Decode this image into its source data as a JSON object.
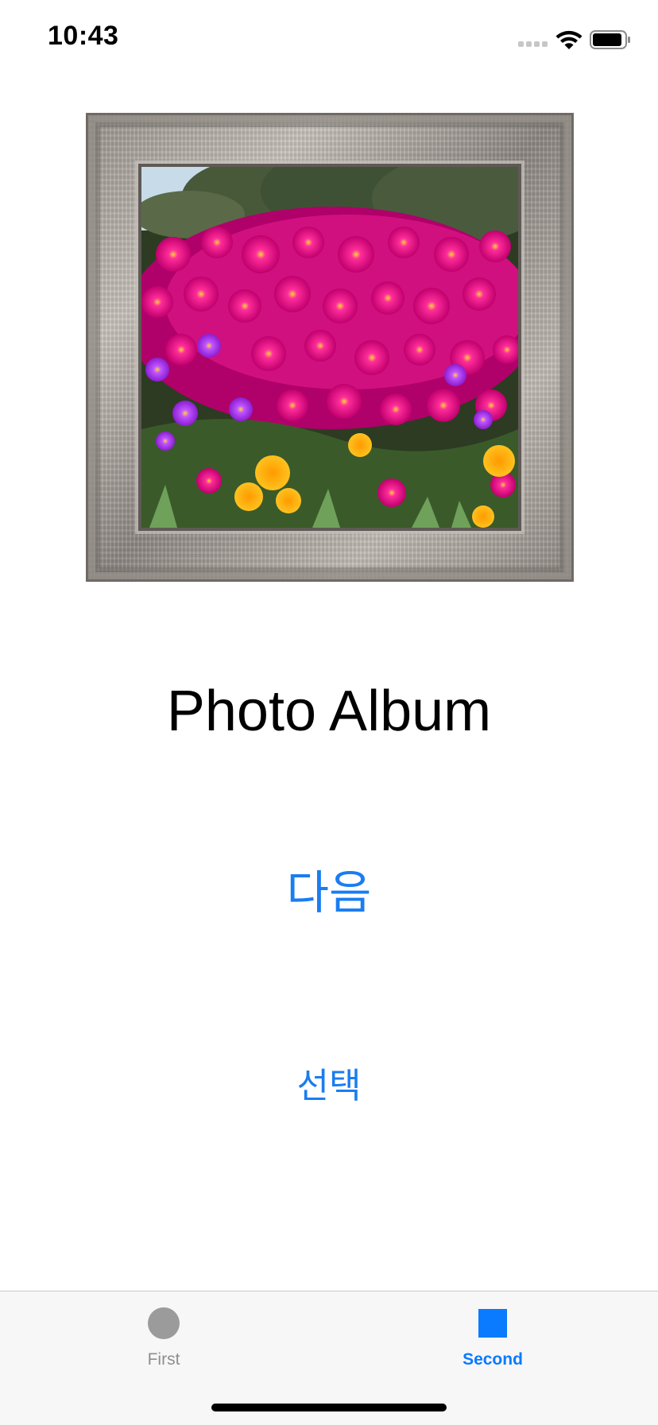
{
  "status_bar": {
    "time": "10:43"
  },
  "main": {
    "title": "Photo Album",
    "next_button_label": "다음",
    "select_button_label": "선택"
  },
  "tab_bar": {
    "tabs": [
      {
        "label": "First",
        "icon": "circle-icon",
        "selected": false
      },
      {
        "label": "Second",
        "icon": "square-icon",
        "selected": true
      }
    ]
  },
  "colors": {
    "accent": "#0a7aff",
    "tab_inactive": "#8e8e8e"
  }
}
